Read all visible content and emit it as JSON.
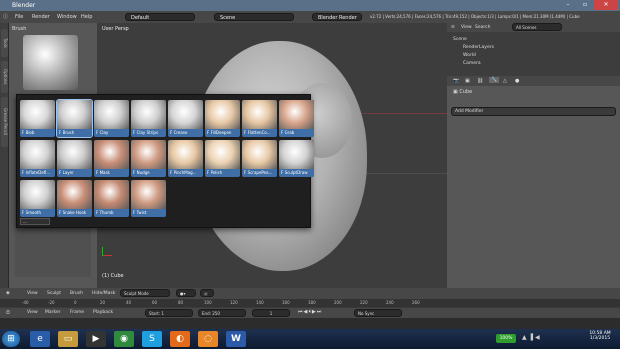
{
  "window": {
    "title": "Blender",
    "min": "–",
    "max": "▫",
    "close": "✕"
  },
  "menubar": {
    "items": [
      "File",
      "Render",
      "Window",
      "Help"
    ],
    "screen_layout": "Default",
    "scene": "Scene",
    "engine": "Blender Render",
    "stats": "v2.72 | Verts:24,576 | Faces:24,576 | Tris:49,152 | Objects:1/3 | Lamps:0/1 | Mem:21.30M (1.44M) | Cube"
  },
  "left_tabs": [
    "Tools",
    "Options",
    "Grease Pencil"
  ],
  "toolshelf": {
    "brush_header": "Brush"
  },
  "viewport": {
    "label": "User Persp",
    "object_label": "(1) Cube"
  },
  "popup": {
    "brushes": [
      {
        "name": "F Blob",
        "tone": "#d8d8d8"
      },
      {
        "name": "F Brush",
        "tone": "#d0d0d0"
      },
      {
        "name": "F Clay",
        "tone": "#cfcfcf"
      },
      {
        "name": "F Clay Strips",
        "tone": "#cfcfcf"
      },
      {
        "name": "F Crease",
        "tone": "#d6d6d6"
      },
      {
        "name": "F FillDeepen",
        "tone": "#e8c9a6"
      },
      {
        "name": "F FlattenCo...",
        "tone": "#e6c6a2"
      },
      {
        "name": "F Grab",
        "tone": "#d9a58b"
      },
      {
        "name": "F InflateDefl...",
        "tone": "#d3d3d3"
      },
      {
        "name": "F Layer",
        "tone": "#cccccc"
      },
      {
        "name": "F Mask",
        "tone": "#c98f78"
      },
      {
        "name": "F Nudge",
        "tone": "#cf9b82"
      },
      {
        "name": "F PinchMag...",
        "tone": "#e7c8a4"
      },
      {
        "name": "F Polish",
        "tone": "#ecd2b2"
      },
      {
        "name": "F ScrapePea...",
        "tone": "#e8c9a6"
      },
      {
        "name": "F SculptDraw",
        "tone": "#d4d4d4"
      },
      {
        "name": "F Smooth",
        "tone": "#d0d0d0"
      },
      {
        "name": "F Snake Hook",
        "tone": "#c98f78"
      },
      {
        "name": "F Thumb",
        "tone": "#c48a72"
      },
      {
        "name": "F Twist",
        "tone": "#cf9b82"
      }
    ],
    "search_text": "..."
  },
  "outliner": {
    "view": "View",
    "search": "Search",
    "filter": "All Scenes",
    "rows": [
      "Scene",
      "RenderLayers",
      "World",
      "Camera"
    ]
  },
  "properties": {
    "object_name": "Cube",
    "add_modifier": "Add Modifier"
  },
  "bottombar": {
    "items": [
      "View",
      "Sculpt",
      "Brush",
      "Hide/Mask"
    ],
    "mode": "Sculpt Mode"
  },
  "timeline": {
    "ticks": [
      "-40",
      "-20",
      "0",
      "20",
      "40",
      "60",
      "80",
      "100",
      "120",
      "140",
      "160",
      "180",
      "200",
      "220",
      "240",
      "260"
    ],
    "menu": [
      "View",
      "Marker",
      "Frame",
      "Playback"
    ],
    "start": "Start:",
    "start_val": "1",
    "end": "End:",
    "end_val": "250",
    "current": "1",
    "sync": "No Sync"
  },
  "taskbar": {
    "battery": "100%",
    "time": "10:58 AM",
    "date": "1/3/2015"
  },
  "colors": {
    "titlebar": "#5a6f88",
    "panel": "#575757",
    "header": "#474747",
    "selection": "#3f6fa6",
    "battery": "#2f9e2f"
  }
}
